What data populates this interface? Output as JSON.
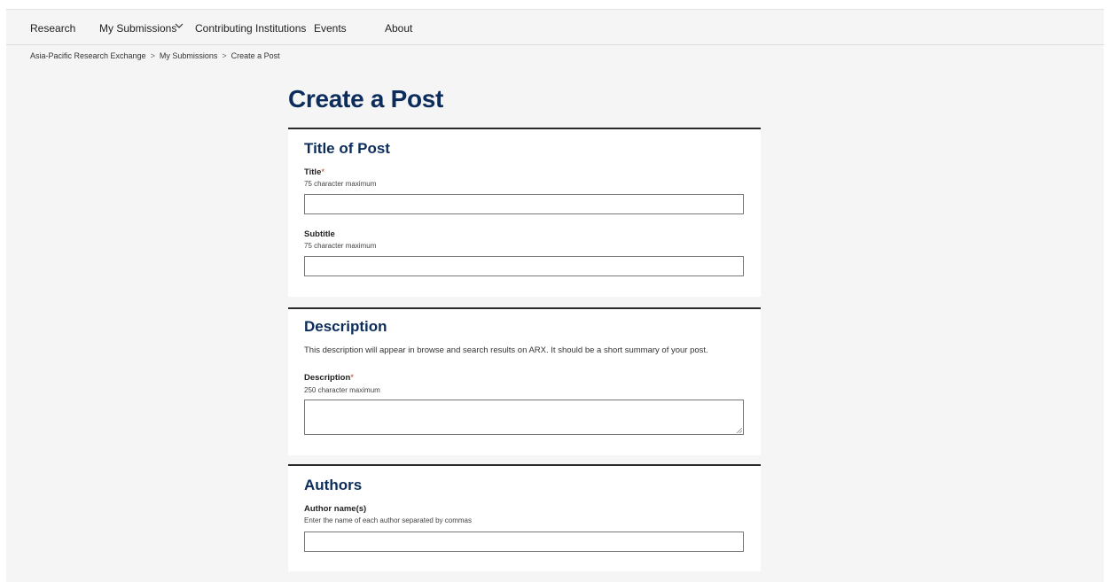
{
  "nav": {
    "items": [
      "Research",
      "My Submissions",
      "Contributing Institutions",
      "Events",
      "About"
    ],
    "dropdown_icon": "chevron-down-icon"
  },
  "breadcrumb": {
    "items": [
      "Asia-Pacific Research Exchange",
      "My Submissions",
      "Create a Post"
    ],
    "separator": ">"
  },
  "page_title": "Create a Post",
  "sections": {
    "title_of_post": {
      "heading": "Title of Post",
      "title_label": "Title",
      "title_required": "*",
      "title_hint": "75 character maximum",
      "title_value": "",
      "subtitle_label": "Subtitle",
      "subtitle_hint": "75 character maximum",
      "subtitle_value": ""
    },
    "description": {
      "heading": "Description",
      "text": "This description will appear in browse and search results on ARX. It should be a short summary of your post.",
      "label": "Description",
      "required": "*",
      "hint": "250 character maximum",
      "value": ""
    },
    "authors": {
      "heading": "Authors",
      "label": "Author name(s)",
      "hint": "Enter the name of each author separated by commas",
      "value": ""
    }
  },
  "colors": {
    "heading": "#0c2d5c",
    "required": "#c0392b",
    "background": "#f5f5f5"
  }
}
